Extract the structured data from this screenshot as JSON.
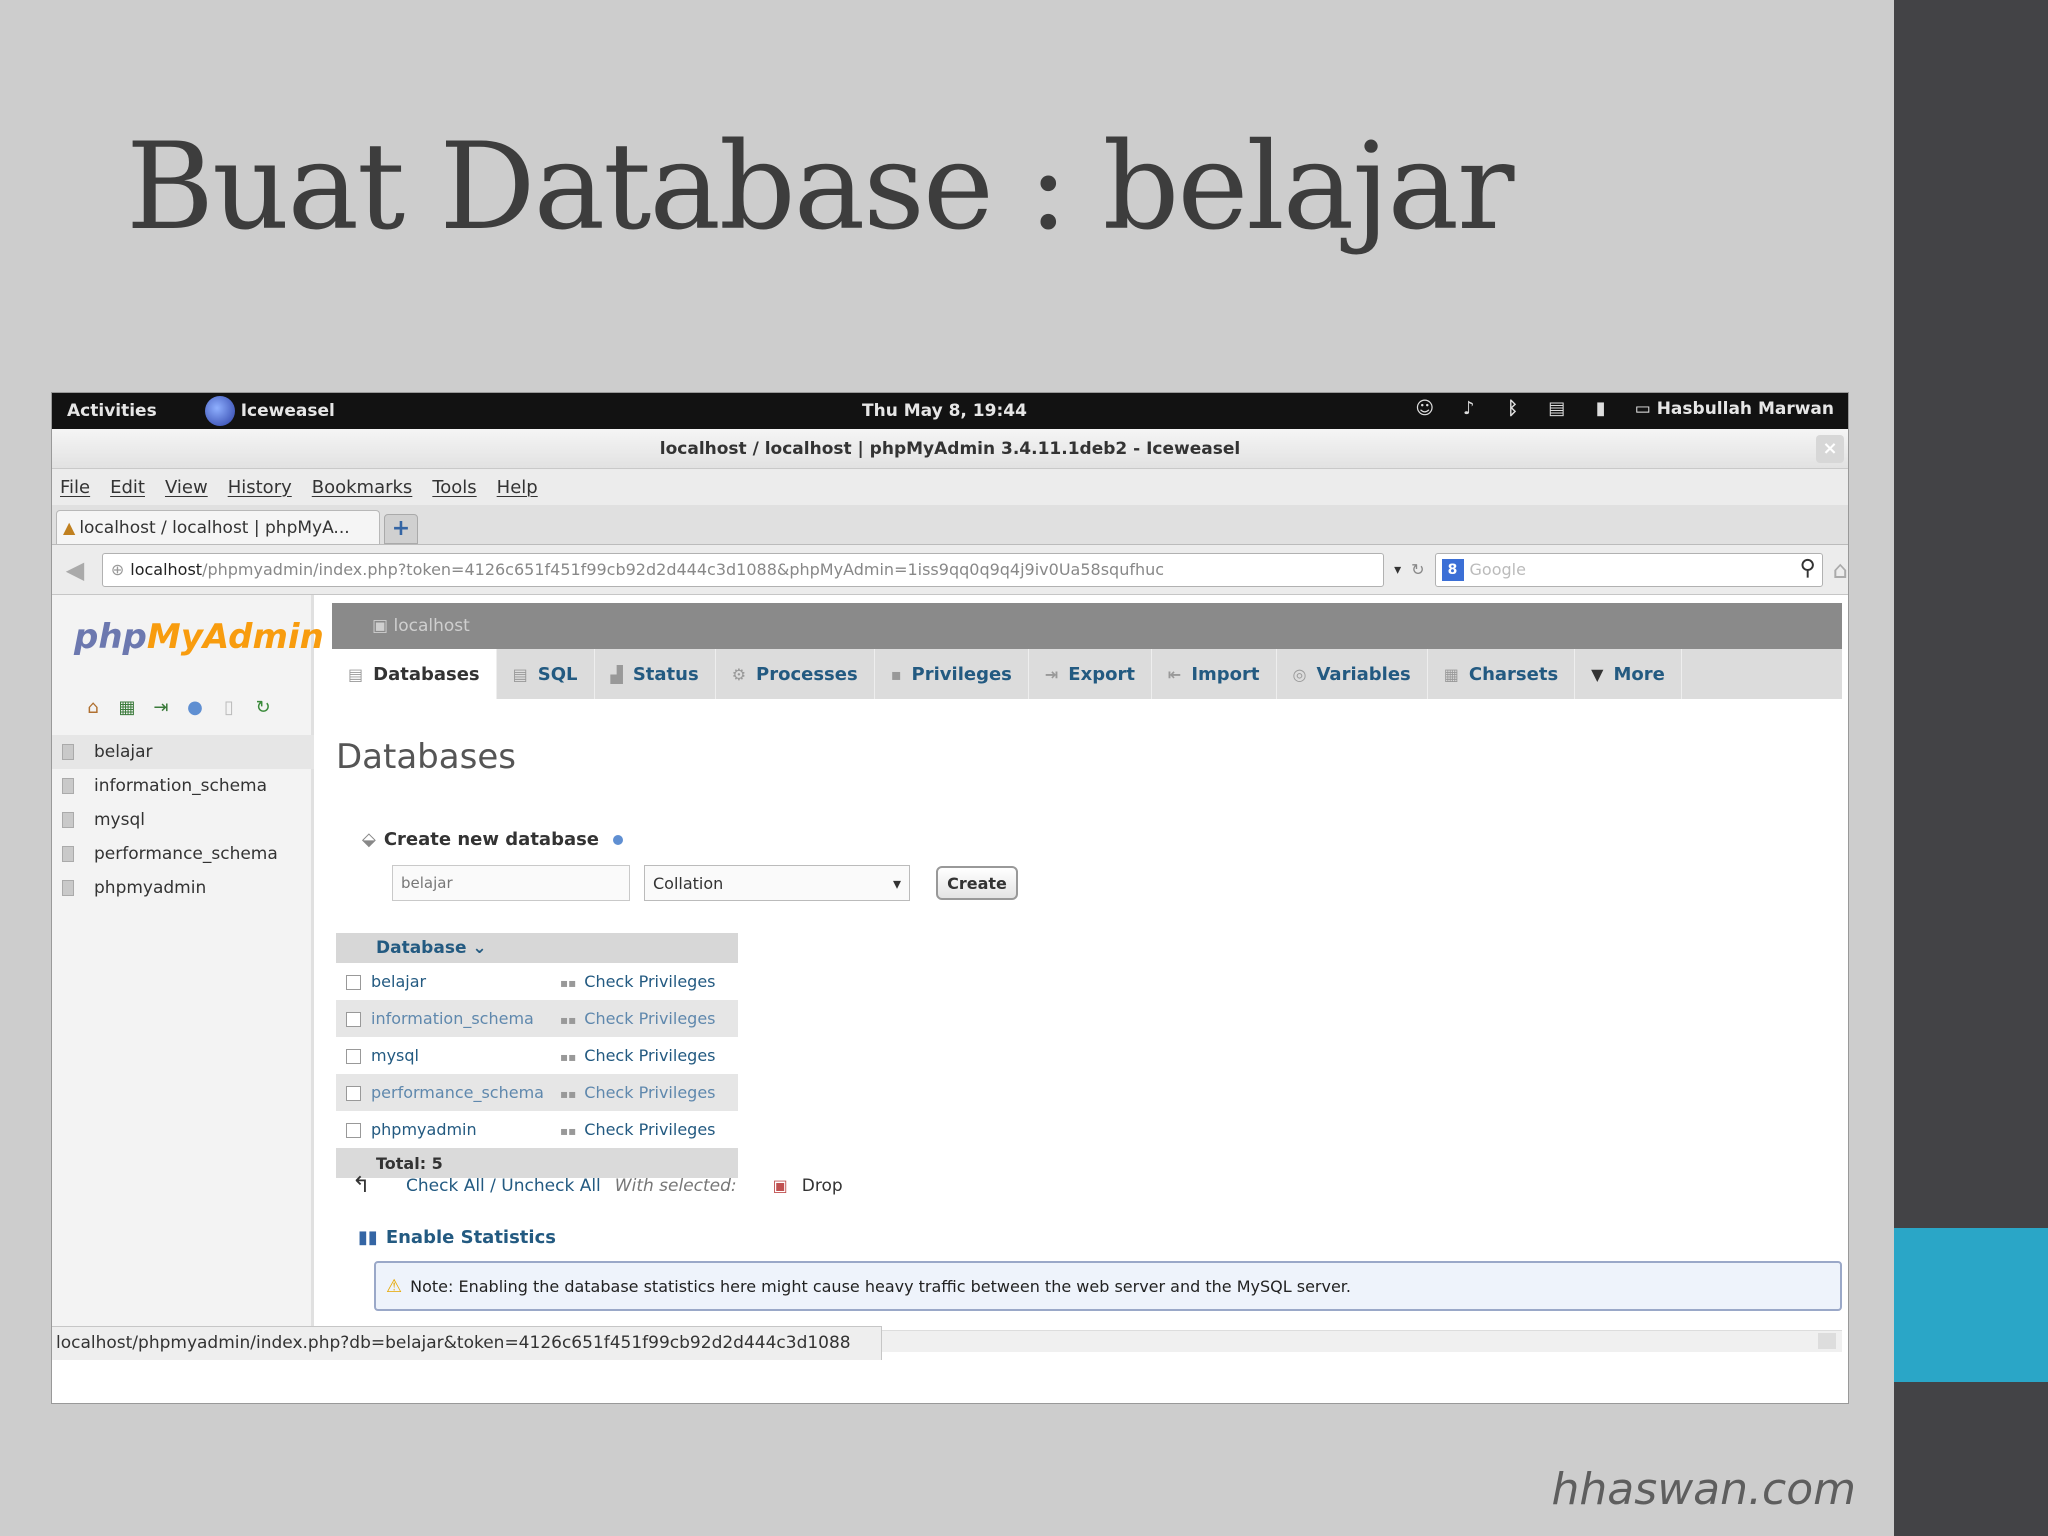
{
  "slide": {
    "title": "Buat Database : belajar",
    "footer": "hhaswan.com",
    "colors": {
      "background": "#cdcdcd",
      "side_bar": "#434346",
      "accent": "#2aa6c7"
    }
  },
  "topbar": {
    "activities": "Activities",
    "app_name": "Iceweasel",
    "clock": "Thu May  8, 19:44",
    "user": "Hasbullah Marwan"
  },
  "window": {
    "title": "localhost / localhost | phpMyAdmin 3.4.11.1deb2 - Iceweasel",
    "close": "×"
  },
  "menu": {
    "items": [
      "File",
      "Edit",
      "View",
      "History",
      "Bookmarks",
      "Tools",
      "Help"
    ]
  },
  "browser": {
    "tab_label": "localhost / localhost | phpMyA...",
    "new_tab": "+",
    "url_host": "localhost",
    "url_path": "/phpmyadmin/index.php?token=4126c651f451f99cb92d2d444c3d1088&phpMyAdmin=1iss9qq0q9q4j9iv0Ua58squfhuc",
    "search_placeholder": "Google",
    "status_url": "localhost/phpmyadmin/index.php?db=belajar&token=4126c651f451f99cb92d2d444c3d1088"
  },
  "pma": {
    "logo_php": "php",
    "logo_myadmin": "MyAdmin",
    "sidebar_databases": [
      "belajar",
      "information_schema",
      "mysql",
      "performance_schema",
      "phpmyadmin"
    ],
    "server_label": "localhost",
    "tabs": [
      "Databases",
      "SQL",
      "Status",
      "Processes",
      "Privileges",
      "Export",
      "Import",
      "Variables",
      "Charsets",
      "More"
    ],
    "heading": "Databases",
    "create_label": "Create new database",
    "new_db_value": "belajar",
    "collation_label": "Collation",
    "create_button": "Create",
    "table_header": "Database",
    "table_rows": [
      "belajar",
      "information_schema",
      "mysql",
      "performance_schema",
      "phpmyadmin"
    ],
    "check_privileges": "Check Privileges",
    "total_label": "Total: 5",
    "check_all": "Check All / Uncheck All",
    "with_selected": "With selected:",
    "drop_label": "Drop",
    "enable_statistics": "Enable Statistics",
    "note": "Note: Enabling the database statistics here might cause heavy traffic between the web server and the MySQL server."
  }
}
